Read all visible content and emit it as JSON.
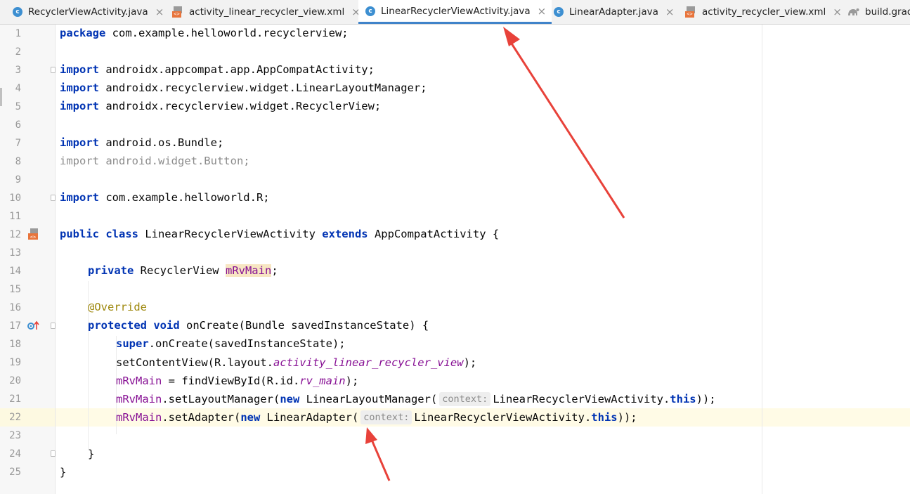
{
  "tabs": [
    {
      "label": "RecyclerViewActivity.java",
      "icon": "class-icon",
      "active": false
    },
    {
      "label": "activity_linear_recycler_view.xml",
      "icon": "xml-icon",
      "active": false
    },
    {
      "label": "LinearRecyclerViewActivity.java",
      "icon": "class-icon",
      "active": true
    },
    {
      "label": "LinearAdapter.java",
      "icon": "class-icon",
      "active": false
    },
    {
      "label": "activity_recycler_view.xml",
      "icon": "xml-icon",
      "active": false
    },
    {
      "label": "build.grad",
      "icon": "gradle-icon",
      "active": false
    }
  ],
  "close_glyph": "×",
  "line_numbers": [
    "1",
    "2",
    "3",
    "4",
    "5",
    "6",
    "7",
    "8",
    "9",
    "10",
    "11",
    "12",
    "13",
    "14",
    "15",
    "16",
    "17",
    "18",
    "19",
    "20",
    "21",
    "22",
    "23",
    "24",
    "25"
  ],
  "code": {
    "l1": {
      "kw": "package",
      "rest": " com.example.helloworld.recyclerview;"
    },
    "l3": {
      "kw": "import",
      "rest": " androidx.appcompat.app.AppCompatActivity;"
    },
    "l4": {
      "kw": "import",
      "rest": " androidx.recyclerview.widget.LinearLayoutManager;"
    },
    "l5": {
      "kw": "import",
      "rest": " androidx.recyclerview.widget.RecyclerView;"
    },
    "l7": {
      "kw": "import",
      "rest": " android.os.Bundle;"
    },
    "l8": {
      "kw": "import",
      "rest": " android.widget.Button;"
    },
    "l10": {
      "kw": "import",
      "rest": " com.example.helloworld.R;"
    },
    "l12": {
      "kw1": "public class",
      "mid": " LinearRecyclerViewActivity ",
      "kw2": "extends",
      "rest": " AppCompatActivity {"
    },
    "l14": {
      "kw": "private",
      "type": " RecyclerView ",
      "field": "mRvMain",
      "end": ";"
    },
    "l16": {
      "ann": "@Override"
    },
    "l17": {
      "kw": "protected void",
      "rest": " onCreate(Bundle savedInstanceState) {"
    },
    "l18": {
      "kw": "super",
      "rest": ".onCreate(savedInstanceState);"
    },
    "l19": {
      "pre": "setContentView(R.layout.",
      "ital": "activity_linear_recycler_view",
      "end": ");"
    },
    "l20": {
      "field": "mRvMain",
      "pre": " = findViewById(R.id.",
      "ital": "rv_main",
      "end": ");"
    },
    "l21": {
      "field": "mRvMain",
      "pre": ".setLayoutManager(",
      "kw": "new",
      "mid": " LinearLayoutManager(",
      "hint": "context:",
      "post": "LinearRecyclerViewActivity.",
      "kw2": "this",
      "end": "));"
    },
    "l22": {
      "field": "mRvMain",
      "pre": ".setAdapter(",
      "kw": "new",
      "mid": " LinearAdapter(",
      "hint": "context:",
      "post": "LinearRecyclerViewActivity.",
      "kw2": "this",
      "end": "));"
    },
    "l24": {
      "text": "}"
    },
    "l25": {
      "text": "}"
    }
  },
  "colors": {
    "keyword": "#0033b3",
    "field": "#871094",
    "annotation": "#9e880d",
    "arrow": "#e8423a",
    "tab_underline": "#4083c9"
  }
}
